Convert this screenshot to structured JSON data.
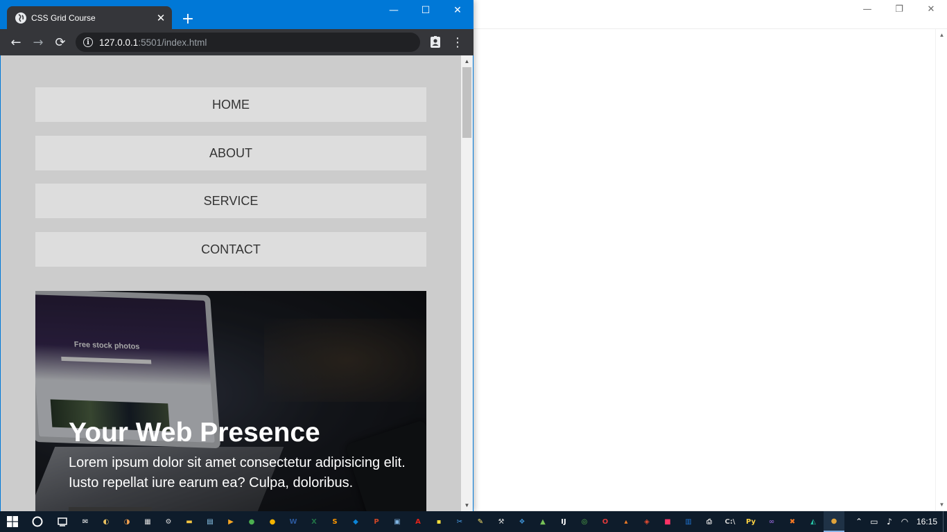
{
  "background_window": {
    "controls": {
      "minimize": "—",
      "restore": "❐",
      "close": "✕"
    }
  },
  "browser": {
    "tab": {
      "title": "CSS Grid Course",
      "close": "✕"
    },
    "new_tab": "+",
    "window_controls": {
      "minimize": "—",
      "maximize": "☐",
      "close": "✕"
    },
    "toolbar": {
      "back": "←",
      "forward": "→",
      "reload": "⟳",
      "menu": "⋮"
    },
    "omnibox": {
      "url_host": "127.0.0.1",
      "url_rest": ":5501/index.html",
      "info": "i"
    }
  },
  "page": {
    "nav": [
      "HOME",
      "ABOUT",
      "SERVICE",
      "CONTACT"
    ],
    "hero": {
      "title": "Your Web Presence",
      "text": "Lorem ipsum dolor sit amet consectetur adipisicing elit. Iusto repellat iure earum ea? Culpa, doloribus.",
      "screen_title": "Free stock photos"
    }
  },
  "taskbar": {
    "apps": [
      {
        "icon": "mail-icon",
        "glyph": "✉",
        "color": "#ffffff"
      },
      {
        "icon": "paint-icon",
        "glyph": "◐",
        "color": "#e8c060"
      },
      {
        "icon": "paint3d-icon",
        "glyph": "◑",
        "color": "#f0a050"
      },
      {
        "icon": "calculator-icon",
        "glyph": "▦",
        "color": "#dddddd"
      },
      {
        "icon": "settings-icon",
        "glyph": "⚙",
        "color": "#dddddd"
      },
      {
        "icon": "file-explorer-icon",
        "glyph": "▬",
        "color": "#f4c542"
      },
      {
        "icon": "notepad-icon",
        "glyph": "▤",
        "color": "#8ecbf0"
      },
      {
        "icon": "media-player-icon",
        "glyph": "▶",
        "color": "#f5a623"
      },
      {
        "icon": "chrome-icon",
        "glyph": "●",
        "color": "#4caf50"
      },
      {
        "icon": "chrome-canary-icon",
        "glyph": "●",
        "color": "#f4b400"
      },
      {
        "icon": "word-icon",
        "glyph": "W",
        "color": "#2b579a"
      },
      {
        "icon": "excel-icon",
        "glyph": "X",
        "color": "#217346"
      },
      {
        "icon": "sublime-icon",
        "glyph": "S",
        "color": "#ff9800"
      },
      {
        "icon": "vscode-icon",
        "glyph": "◆",
        "color": "#0a84d8"
      },
      {
        "icon": "powerpoint-icon",
        "glyph": "P",
        "color": "#d24726"
      },
      {
        "icon": "remote-desktop-icon",
        "glyph": "▣",
        "color": "#7fb3e0"
      },
      {
        "icon": "acrobat-icon",
        "glyph": "A",
        "color": "#e2231a"
      },
      {
        "icon": "sticky-notes-icon",
        "glyph": "▪",
        "color": "#f7dd3b"
      },
      {
        "icon": "snipping-tool-icon",
        "glyph": "✂",
        "color": "#4aa3f0"
      },
      {
        "icon": "notes-icon",
        "glyph": "✎",
        "color": "#f9e26a"
      },
      {
        "icon": "tools-icon",
        "glyph": "⚒",
        "color": "#dddddd"
      },
      {
        "icon": "virtualbox-icon",
        "glyph": "❖",
        "color": "#3d8fd1"
      },
      {
        "icon": "android-icon",
        "glyph": "▲",
        "color": "#78c257"
      },
      {
        "icon": "intellij-icon",
        "glyph": "IJ",
        "color": "#ffffff"
      },
      {
        "icon": "android-studio-icon",
        "glyph": "◎",
        "color": "#59b84a"
      },
      {
        "icon": "opera-icon",
        "glyph": "O",
        "color": "#e23a3a"
      },
      {
        "icon": "matlab-icon",
        "glyph": "▴",
        "color": "#ef7b26"
      },
      {
        "icon": "git-icon",
        "glyph": "◈",
        "color": "#e84d31"
      },
      {
        "icon": "app-pink-icon",
        "glyph": "■",
        "color": "#ff3366"
      },
      {
        "icon": "document-icon",
        "glyph": "▥",
        "color": "#1f74d1"
      },
      {
        "icon": "printer-icon",
        "glyph": "⎙",
        "color": "#dddddd"
      },
      {
        "icon": "cmd-icon",
        "glyph": "C:\\",
        "color": "#cfcfcf"
      },
      {
        "icon": "python-icon",
        "glyph": "Py",
        "color": "#ffd343"
      },
      {
        "icon": "visual-studio-icon",
        "glyph": "∞",
        "color": "#865fc5"
      },
      {
        "icon": "xampp-icon",
        "glyph": "✖",
        "color": "#fb7a24"
      },
      {
        "icon": "gitkraken-icon",
        "glyph": "◭",
        "color": "#27c3a6"
      },
      {
        "icon": "chrome-active-icon",
        "glyph": "●",
        "color": "#e0a33a"
      }
    ],
    "tray": {
      "chevron": "⌃",
      "battery": "▭",
      "volume": "♪",
      "network": "◠",
      "time": "16:15"
    }
  }
}
